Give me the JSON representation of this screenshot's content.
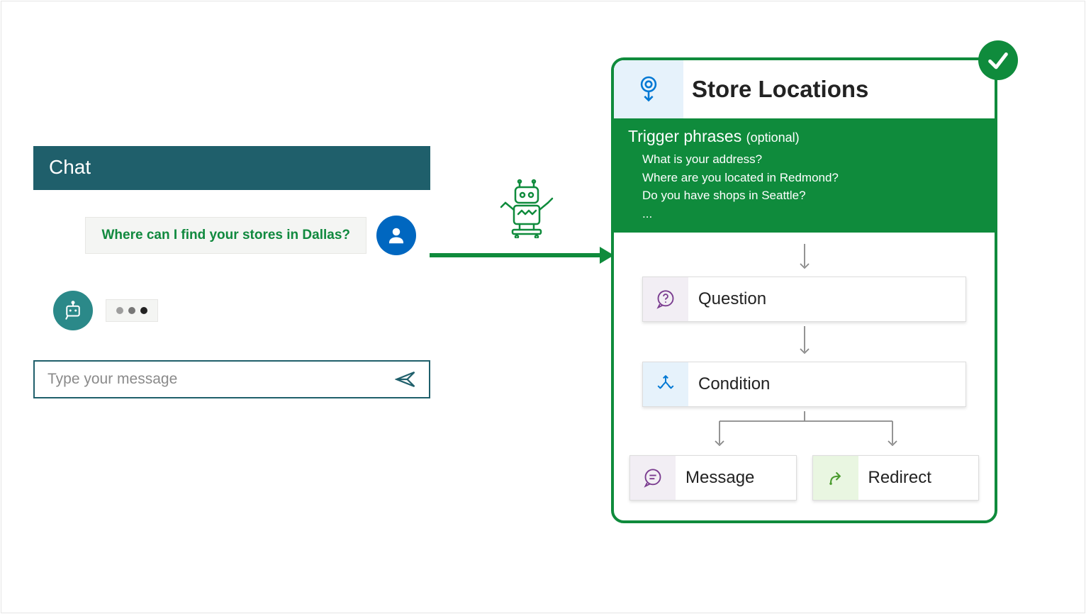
{
  "chat": {
    "title": "Chat",
    "user_message": "Where can I find your stores in Dallas?",
    "input_placeholder": "Type your message"
  },
  "flow": {
    "title": "Store Locations",
    "trigger_heading": "Trigger phrases",
    "trigger_optional": "(optional)",
    "trigger_phrases": [
      "What is your address?",
      "Where are you located in Redmond?",
      "Do you have shops in Seattle?",
      "..."
    ],
    "nodes": {
      "question": "Question",
      "condition": "Condition",
      "message": "Message",
      "redirect": "Redirect"
    }
  },
  "icons": {
    "trigger": "trigger-icon",
    "question": "chat-question-icon",
    "condition": "branch-icon",
    "message": "chat-message-icon",
    "redirect": "redirect-icon",
    "send": "send-icon",
    "user": "user-avatar-icon",
    "bot": "bot-avatar-icon",
    "robot": "robot-icon",
    "check": "checkmark-icon"
  }
}
